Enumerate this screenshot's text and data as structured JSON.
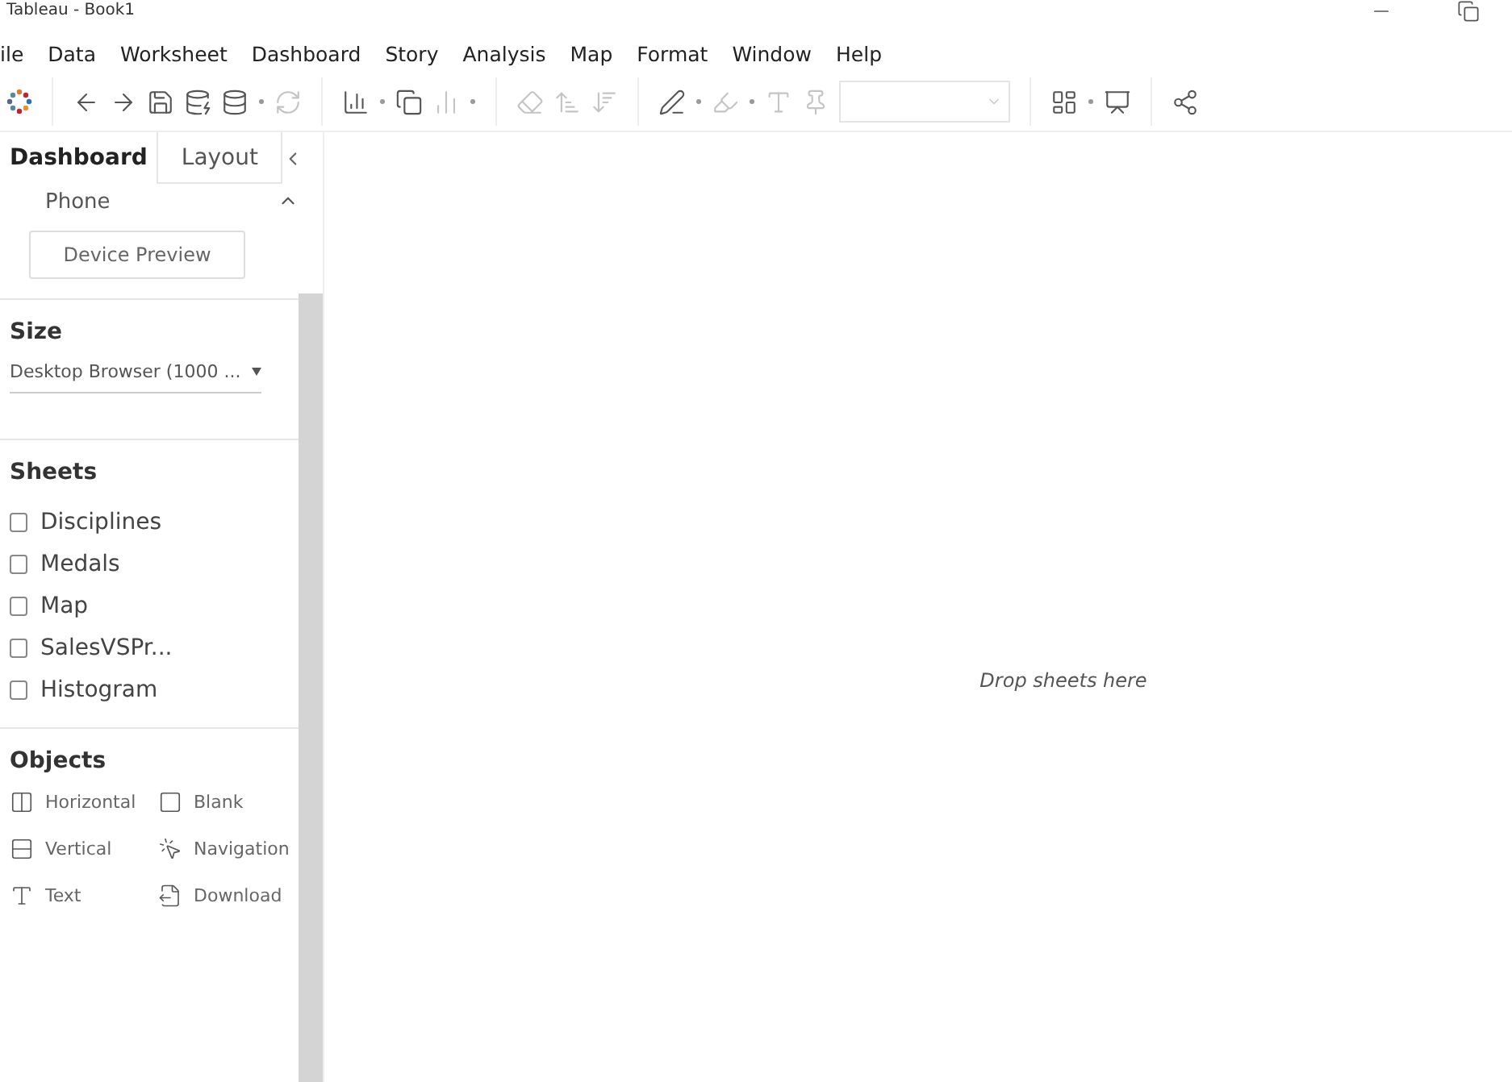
{
  "window": {
    "title": "Tableau - Book1"
  },
  "menu": [
    "ile",
    "Data",
    "Worksheet",
    "Dashboard",
    "Story",
    "Analysis",
    "Map",
    "Format",
    "Window",
    "Help"
  ],
  "side_tabs": [
    {
      "label": "Dashboard",
      "selected": true
    },
    {
      "label": "Layout",
      "selected": false
    }
  ],
  "device": {
    "label": "Phone",
    "button": "Device Preview"
  },
  "size": {
    "title": "Size",
    "value": "Desktop Browser (1000 ..."
  },
  "sheets": {
    "title": "Sheets",
    "items": [
      "Disciplines",
      "Medals",
      "Map",
      "SalesVSPr...",
      "Histogram"
    ]
  },
  "objects": {
    "title": "Objects",
    "items": [
      {
        "label": "Horizontal",
        "kind": "horizontal"
      },
      {
        "label": "Blank",
        "kind": "blank"
      },
      {
        "label": "Vertical",
        "kind": "vertical"
      },
      {
        "label": "Navigation",
        "kind": "navigation"
      },
      {
        "label": "Text",
        "kind": "text"
      },
      {
        "label": "Download",
        "kind": "download"
      }
    ]
  },
  "canvas": {
    "hint": "Drop sheets here"
  }
}
